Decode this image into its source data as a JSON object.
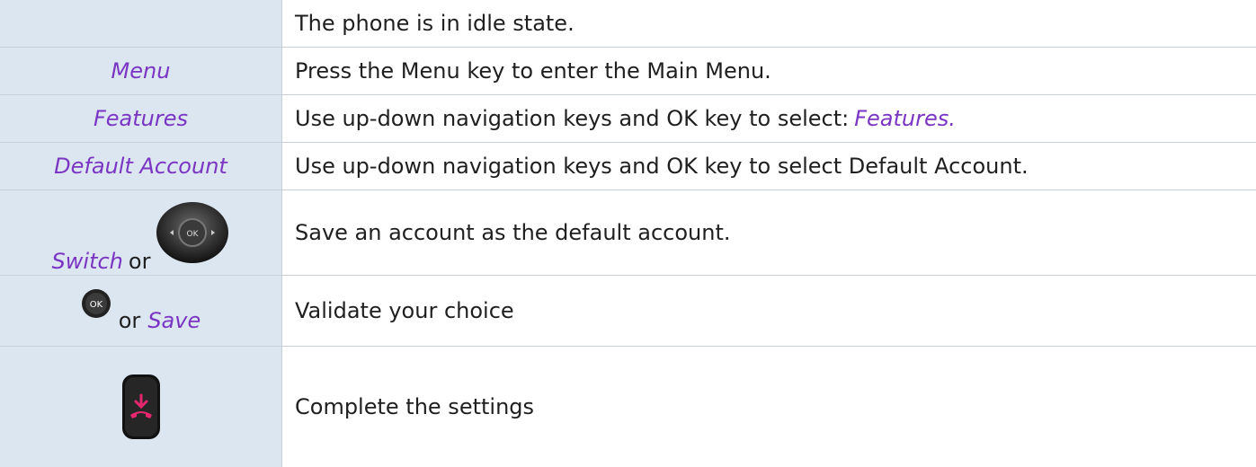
{
  "rows": [
    {
      "left": "",
      "right": "The phone is in idle state."
    },
    {
      "left": "Menu",
      "right": "Press the Menu key to enter the Main Menu."
    },
    {
      "left": "Features",
      "right_prefix": "Use up-down navigation keys and OK key to select: ",
      "right_italic": "Features."
    },
    {
      "left": "Default Account",
      "right": "Use up-down navigation keys and OK key to select Default Account."
    },
    {
      "left_italic": "Switch",
      "left_plain": " or",
      "right": "Save an account as the default account.",
      "icon": "navigation-key-icon"
    },
    {
      "left_plain": " or ",
      "left_italic": "Save",
      "right": "Validate your choice",
      "icon": "ok-key-icon",
      "icon_label": "OK"
    },
    {
      "left": "",
      "right": "Complete the settings",
      "icon": "hang-up-key-icon"
    }
  ],
  "colors": {
    "accent": "#7a35c3",
    "cell_bg": "#dce6f1",
    "border": "#c9cfd6"
  }
}
